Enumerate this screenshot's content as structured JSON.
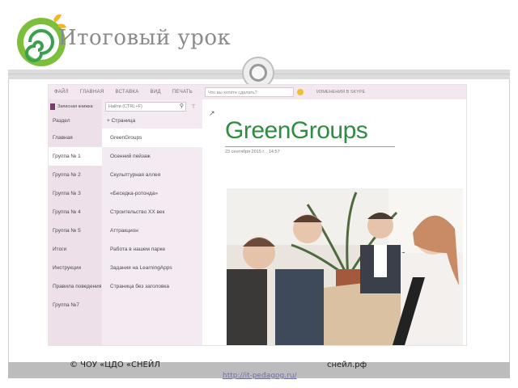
{
  "slide": {
    "title": "Итоговый урок",
    "footer_left": "© ЧОУ «ЦДО «СНЕЙЛ",
    "footer_right": "снейл.рф",
    "footer_url": "http://it-pedagog.ru/"
  },
  "ribbon": {
    "tabs": [
      "Файл",
      "Главная",
      "Вставка",
      "Вид",
      "Печать"
    ],
    "tell_me_placeholder": "Что вы хотите сделать?",
    "changes_label": "Изменения в Skype"
  },
  "notebook": {
    "name": "Записная книжка",
    "sections_header": "Раздел",
    "sections": [
      {
        "label": "Главная",
        "active": false
      },
      {
        "label": "Группа № 1",
        "active": true
      },
      {
        "label": "Группа № 2",
        "active": false
      },
      {
        "label": "Группа № 3",
        "active": false
      },
      {
        "label": "Группа № 4",
        "active": false
      },
      {
        "label": "Группа № 5",
        "active": false
      },
      {
        "label": "Итоги",
        "active": false
      },
      {
        "label": "Инструкции",
        "active": false
      },
      {
        "label": "Правила поведения",
        "active": false
      },
      {
        "label": "Группа №7",
        "active": false
      }
    ]
  },
  "pages": {
    "search_placeholder": "Найти (CTRL+F)",
    "add_page_label": "Страница",
    "items": [
      {
        "label": "GreenGroups",
        "active": true
      },
      {
        "label": "Осенний пейзаж",
        "active": false
      },
      {
        "label": "Скульптурная аллея",
        "active": false
      },
      {
        "label": "«Беседка-ротонда»",
        "active": false
      },
      {
        "label": "Строительство ХХ век",
        "active": false
      },
      {
        "label": "Аттракцион",
        "active": false
      },
      {
        "label": "Работа в нашем парке",
        "active": false
      },
      {
        "label": "Задания на LearningApps",
        "active": false
      },
      {
        "label": "Страница без заголовка",
        "active": false
      }
    ]
  },
  "content": {
    "page_title": "GreenGroups",
    "date": "23 сентября 2015 г.",
    "time": "14:57"
  },
  "colors": {
    "accent_green": "#2f8c42",
    "sidebar_pink": "#ede0e9",
    "footer_gray": "#bcbcbc"
  }
}
